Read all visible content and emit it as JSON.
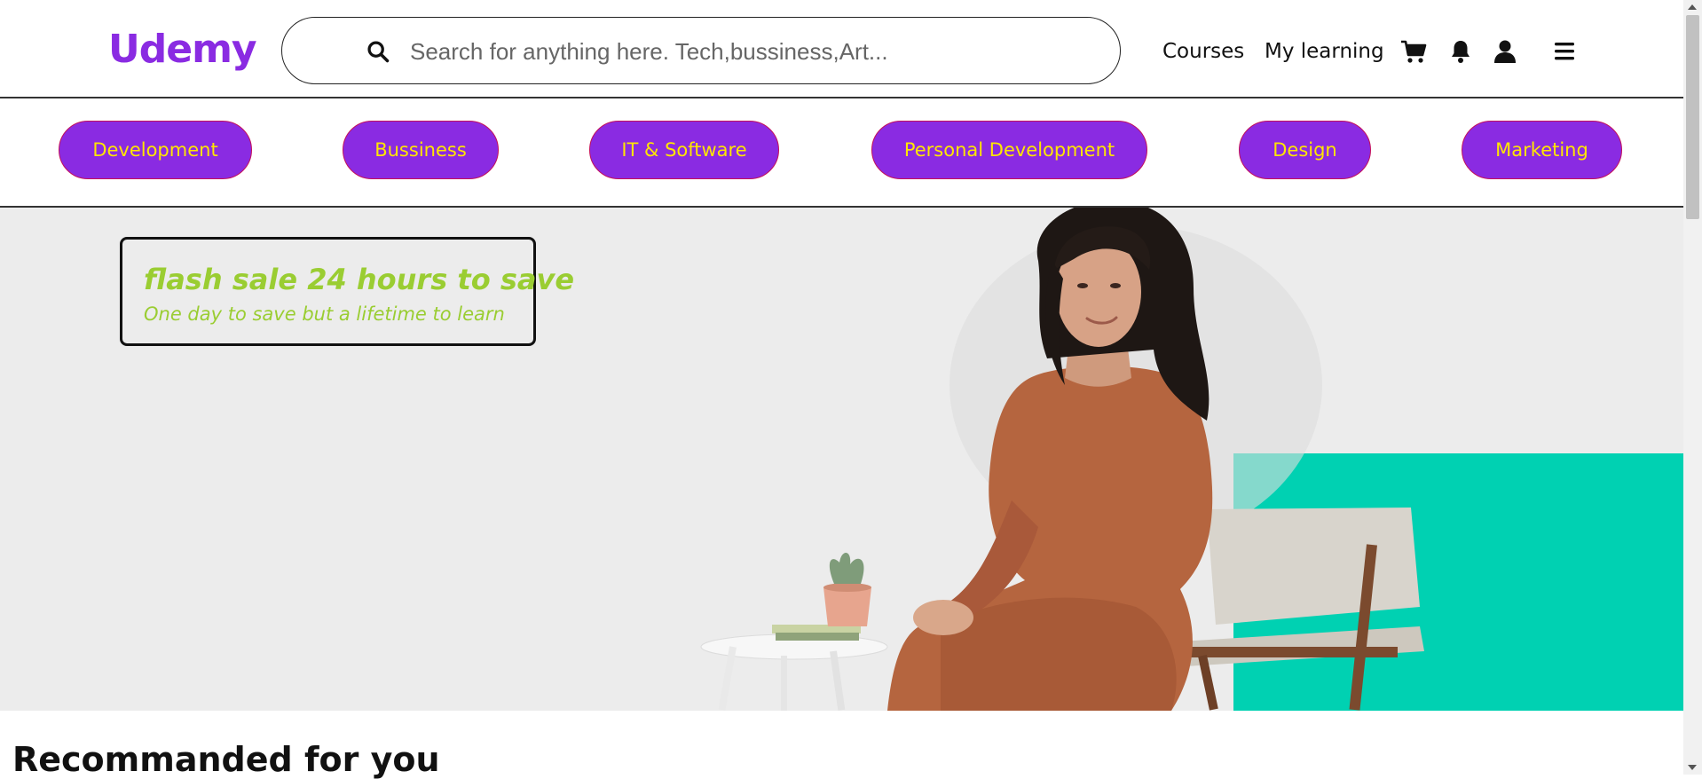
{
  "header": {
    "logo": "Udemy",
    "search": {
      "placeholder": "Search for anything here. Tech,bussiness,Art...",
      "value": ""
    },
    "nav": {
      "courses": "Courses",
      "my_learning": "My learning"
    },
    "icons": [
      "search-icon",
      "cart-icon",
      "bell-icon",
      "user-icon",
      "menu-icon"
    ]
  },
  "categories": [
    "Development",
    "Bussiness",
    "IT & Software",
    "Personal Development",
    "Design",
    "Marketing"
  ],
  "hero": {
    "sale_title": "flash sale 24 hours to save",
    "sale_subtitle": "One day to save but a lifetime to learn"
  },
  "sections": {
    "recommended_title": "Recommanded for you"
  },
  "colors": {
    "brand": "#8a2be2",
    "pill_text": "#ffe600",
    "pill_border": "#c4105a",
    "sale_text": "#9acd32",
    "hero_bg": "#ececec",
    "accent_teal": "#00d1b2"
  }
}
